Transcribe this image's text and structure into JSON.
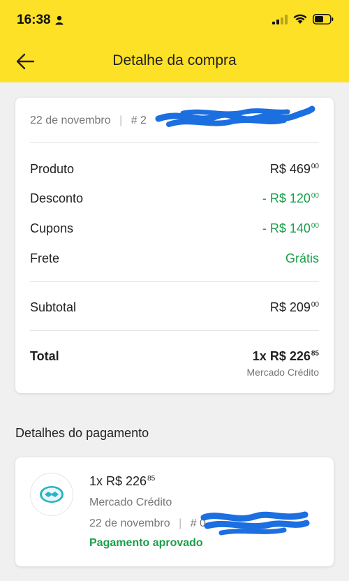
{
  "status_bar": {
    "time": "16:38"
  },
  "header": {
    "title": "Detalhe da compra"
  },
  "summary": {
    "date": "22 de novembro",
    "separator": "|",
    "order_prefix": "# 2",
    "rows": [
      {
        "label": "Produto",
        "prefix": "",
        "amount": "R$ 469",
        "cents": "00",
        "color": "#222222"
      },
      {
        "label": "Desconto",
        "prefix": "- ",
        "amount": "R$ 120",
        "cents": "00",
        "color": "#1a9e49"
      },
      {
        "label": "Cupons",
        "prefix": "- ",
        "amount": "R$ 140",
        "cents": "00",
        "color": "#1a9e49"
      },
      {
        "label": "Frete",
        "value": "Grátis",
        "color": "#1a9e49"
      }
    ],
    "subtotal": {
      "label": "Subtotal",
      "amount": "R$ 209",
      "cents": "00"
    },
    "total": {
      "label": "Total",
      "amount": "1x R$ 226",
      "cents": "85",
      "method": "Mercado Crédito"
    }
  },
  "payment": {
    "section_title": "Detalhes do pagamento",
    "amount": "1x R$ 226",
    "cents": "85",
    "method": "Mercado Crédito",
    "date": "22 de novembro",
    "separator": "|",
    "order_prefix": "# 0",
    "status": "Pagamento aprovado",
    "logo_icon": "mercado-pago-handshake-icon"
  },
  "colors": {
    "header": "#fde126",
    "green": "#1a9e49",
    "scribble": "#1b6fe0"
  }
}
